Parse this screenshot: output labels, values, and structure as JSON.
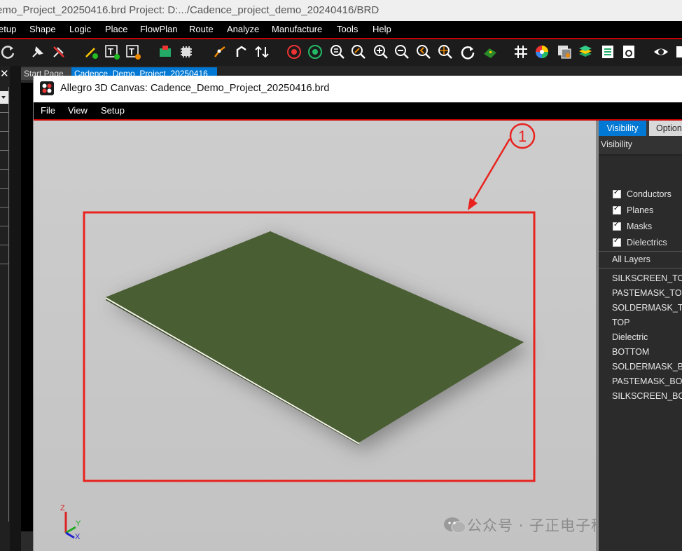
{
  "main_window": {
    "title": "emo_Project_20250416.brd  Project: D:.../Cadence_project_demo_20240416/BRD",
    "menu": [
      "etup",
      "Shape",
      "Logic",
      "Place",
      "FlowPlan",
      "Route",
      "Analyze",
      "Manufacture",
      "Tools",
      "Help"
    ],
    "tabs": [
      "Start Page",
      "Cadence_Demo_Project_20250416"
    ],
    "close_glyph": "✕"
  },
  "window_3d": {
    "title": "Allegro 3D Canvas: Cadence_Demo_Project_20250416.brd",
    "menu": [
      "File",
      "View",
      "Setup"
    ]
  },
  "side_panel": {
    "tabs": [
      "Visibility",
      "Option"
    ],
    "section_title": "Visibility",
    "checkboxes": [
      {
        "label": "Conductors",
        "checked": true
      },
      {
        "label": "Planes",
        "checked": true
      },
      {
        "label": "Masks",
        "checked": true
      },
      {
        "label": "Dielectrics",
        "checked": true
      }
    ],
    "all_layers_label": "All Layers",
    "layers": [
      "SILKSCREEN_TOP",
      "PASTEMASK_TOP",
      "SOLDERMASK_TOP",
      "TOP",
      "Dielectric",
      "BOTTOM",
      "SOLDERMASK_BOTTOM",
      "PASTEMASK_BOTTOM",
      "SILKSCREEN_BOTTOM"
    ]
  },
  "annotation": {
    "marker": "1",
    "color": "#e8231f"
  },
  "axes": {
    "z": "Z",
    "y": "Y",
    "x": "X"
  },
  "watermark": "公众号 · 子正电子科技",
  "colors": {
    "board": "#4a5e33",
    "menu_accent": "#cc0000",
    "tab_active": "#0078d4"
  }
}
